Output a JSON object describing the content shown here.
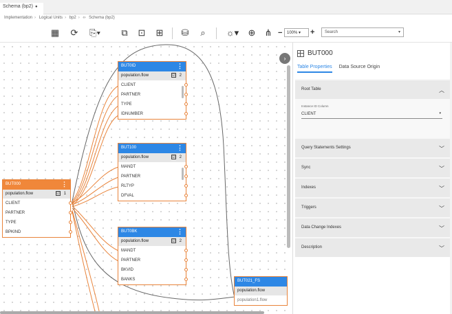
{
  "tab": {
    "title": "Schema (bp2)"
  },
  "breadcrumb": [
    "Implementation",
    "Logical Units",
    "bp2",
    "Schema (bp2)"
  ],
  "toolbar": {
    "icons": [
      "table-icon",
      "refresh-icon",
      "export-icon",
      "fit-icon",
      "focus-icon",
      "layout-icon",
      "database-icon",
      "query-icon",
      "bulb-icon",
      "zoom-in-icon",
      "tree-icon"
    ],
    "zoom": "100%",
    "search_placeholder": "Search"
  },
  "tables": [
    {
      "id": "BUT0ID",
      "flow": "population.flow",
      "checked": "☑",
      "count": "2",
      "columns": [
        "CLIENT",
        "PARTNER",
        "TYPE",
        "IDNUMBER"
      ]
    },
    {
      "id": "BUT100",
      "flow": "population.flow",
      "checked": "☑",
      "count": "2",
      "columns": [
        "MANDT",
        "PARTNER",
        "RLTYP",
        "DFVAL"
      ]
    },
    {
      "id": "BUT000",
      "flow": "population.flow",
      "checked": "☑",
      "count": "1",
      "columns": [
        "CLIENT",
        "PARTNER",
        "TYPE",
        "BPKIND"
      ]
    },
    {
      "id": "BUT0BK",
      "flow": "population.flow",
      "checked": "☑",
      "count": "2",
      "columns": [
        "MANDT",
        "PARTNER",
        "BKVID",
        "BANKS"
      ]
    },
    {
      "id": "BUT021_FS",
      "flow": "population.flow",
      "flow2": "population1.flow",
      "columns": []
    }
  ],
  "panel": {
    "title": "BUT000",
    "tabs": [
      "Table Properties",
      "Data Source Origin"
    ],
    "sections": {
      "root_table": "Root Table",
      "instance_label": "Instance ID Column",
      "instance_value": "CLIENT",
      "others": [
        "Query Statements Settings",
        "Sync",
        "Indexes",
        "Triggers",
        "Data Change Indexes",
        "Description"
      ]
    }
  },
  "colors": {
    "blue_header": "#2d87e5",
    "orange_header": "#f0873a",
    "link_orange": "#e8833a"
  }
}
